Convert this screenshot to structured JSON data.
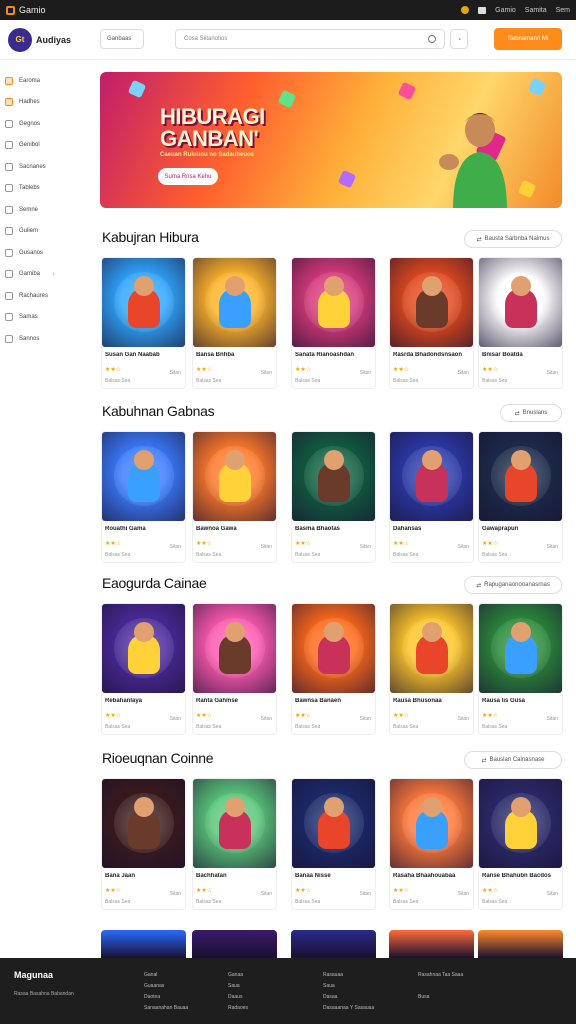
{
  "os_bar": {
    "app_name": "Gamio",
    "items": [
      "Gamio",
      "Samita",
      "Sem"
    ]
  },
  "header": {
    "logo_mark": "Gt",
    "logo_text": "Audiyas",
    "category_select": "Ganbaas",
    "search_placeholder": "Cosa Siitanotios",
    "cta_label": "Sebnamann Mi"
  },
  "sidebar": {
    "items": [
      {
        "label": "Earoma",
        "active": true
      },
      {
        "label": "Hadhes",
        "active": true
      },
      {
        "label": "Gegnos"
      },
      {
        "label": "Genibol"
      },
      {
        "label": "Sacnanes"
      },
      {
        "label": "Tablebs"
      },
      {
        "label": "Semne"
      },
      {
        "label": "Guliem"
      },
      {
        "label": "Gusanos"
      },
      {
        "label": "Gamiba",
        "chevron": true
      },
      {
        "label": "Rachaures"
      },
      {
        "label": "Samas"
      },
      {
        "label": "Sannos"
      }
    ]
  },
  "hero": {
    "title_line1": "HIBURAGI",
    "title_line2": "GANBAN'",
    "subtitle": "Caeuan Ruiuuou no Sadaubeuos",
    "button": "Suma Rnsa Kehu"
  },
  "sections": [
    {
      "title": "Kabujran Hibura",
      "see_all": "Bausta Sarbnba Naimus",
      "cards": [
        {
          "name": "Susan Gan Naabab",
          "stars": "★★☆",
          "meta": "Balsas Sea",
          "plays": "Sitan"
        },
        {
          "name": "Bansa Bnhba",
          "stars": "★★☆",
          "meta": "Balsas Sea",
          "plays": "Sitan"
        },
        {
          "name": "Sanata Rianoashdan",
          "stars": "★★☆",
          "meta": "Balsas Sea",
          "plays": "Sitan"
        },
        {
          "name": "Rasrda Bhadondsnsaon",
          "stars": "★★☆",
          "meta": "Balsas Sea",
          "plays": "Sitan"
        },
        {
          "name": "Bnisar Boatda",
          "stars": "★★☆",
          "meta": "Balsas Sea",
          "plays": "Sitan"
        }
      ]
    },
    {
      "title": "Kabuhnan Gabnas",
      "see_all": "Bnuslans",
      "cards": [
        {
          "name": "Rouathi Gama",
          "stars": "★★☆",
          "meta": "Balsas Sea",
          "plays": "Sitan"
        },
        {
          "name": "Bawnoa Gawa",
          "stars": "★★☆",
          "meta": "Balsas Sea",
          "plays": "Sitan"
        },
        {
          "name": "Basma Bhaotas",
          "stars": "★★☆",
          "meta": "Balsas Sea",
          "plays": "Sitan"
        },
        {
          "name": "Dahansas",
          "stars": "★★☆",
          "meta": "Balsas Sea",
          "plays": "Sitan"
        },
        {
          "name": "Gawaprapun",
          "stars": "★★☆",
          "meta": "Balsas Sea",
          "plays": "Sitan"
        }
      ]
    },
    {
      "title": "Eaogurda Cainae",
      "see_all": "Rapuganaonooanasrnas",
      "cards": [
        {
          "name": "Rebahanlaya",
          "stars": "★★☆",
          "meta": "Balsas Sea",
          "plays": "Sitan"
        },
        {
          "name": "Ranta Gahmse",
          "stars": "★★☆",
          "meta": "Balsas Sea",
          "plays": "Sitan"
        },
        {
          "name": "Bawnsa Banaen",
          "stars": "★★☆",
          "meta": "Balsas Sea",
          "plays": "Sitan"
        },
        {
          "name": "Rausa Bhusonaa",
          "stars": "★★☆",
          "meta": "Balsas Sea",
          "plays": "Sitan"
        },
        {
          "name": "Rausa lis Gusa",
          "stars": "★★☆",
          "meta": "Balsas Sea",
          "plays": "Sitan"
        }
      ]
    },
    {
      "title": "Rioeuqnan Coinne",
      "see_all": "Bauslan Calnasnase",
      "cards": [
        {
          "name": "Bana Jaan",
          "stars": "★★☆",
          "meta": "Balsas Sea",
          "plays": "Sitan"
        },
        {
          "name": "Bachhatan",
          "stars": "★★☆",
          "meta": "Balsas Sea",
          "plays": "Sitan"
        },
        {
          "name": "Banaa Nisse",
          "stars": "★★☆",
          "meta": "Balsas Sea",
          "plays": "Sitan"
        },
        {
          "name": "Rasaha Bhaahouabaa",
          "stars": "★★☆",
          "meta": "Balsas Sea",
          "plays": "Sitan"
        },
        {
          "name": "Ranse Bhahubn Bacdos",
          "stars": "★★☆",
          "meta": "Balsas Sea",
          "plays": "Sitan"
        }
      ]
    }
  ],
  "footer": {
    "brand": "Magunaa",
    "description": "Rasaa Basahna Babandan",
    "columns": [
      [
        "Ganal",
        "Guaanas",
        "Daotea",
        "Sanaanahan Bauaa"
      ],
      [
        "Ganaa",
        "Saua",
        "Daaus",
        "Radaoes"
      ],
      [
        "Rasauaa",
        "Saua",
        "Dasaa",
        "Dasaaanaa Y Sasauaa"
      ],
      [
        "Rasahnaa Taa Saaa",
        "",
        "Busa"
      ]
    ]
  }
}
